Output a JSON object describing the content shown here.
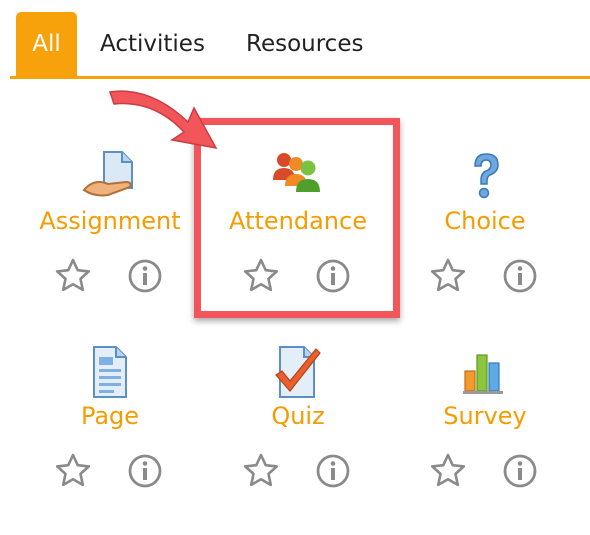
{
  "tabs": [
    {
      "label": "All",
      "active": true
    },
    {
      "label": "Activities",
      "active": false
    },
    {
      "label": "Resources",
      "active": false
    }
  ],
  "colors": {
    "accent": "#f7a10b",
    "link": "#f59c00",
    "highlight": "#f2565a",
    "icon_gray": "#8a8a8a"
  },
  "modules": [
    {
      "name": "Assignment",
      "icon": "assignment-icon"
    },
    {
      "name": "Attendance",
      "icon": "attendance-icon",
      "highlighted": true
    },
    {
      "name": "Choice",
      "icon": "choice-icon"
    },
    {
      "name": "Page",
      "icon": "page-icon"
    },
    {
      "name": "Quiz",
      "icon": "quiz-icon"
    },
    {
      "name": "Survey",
      "icon": "survey-icon"
    }
  ]
}
